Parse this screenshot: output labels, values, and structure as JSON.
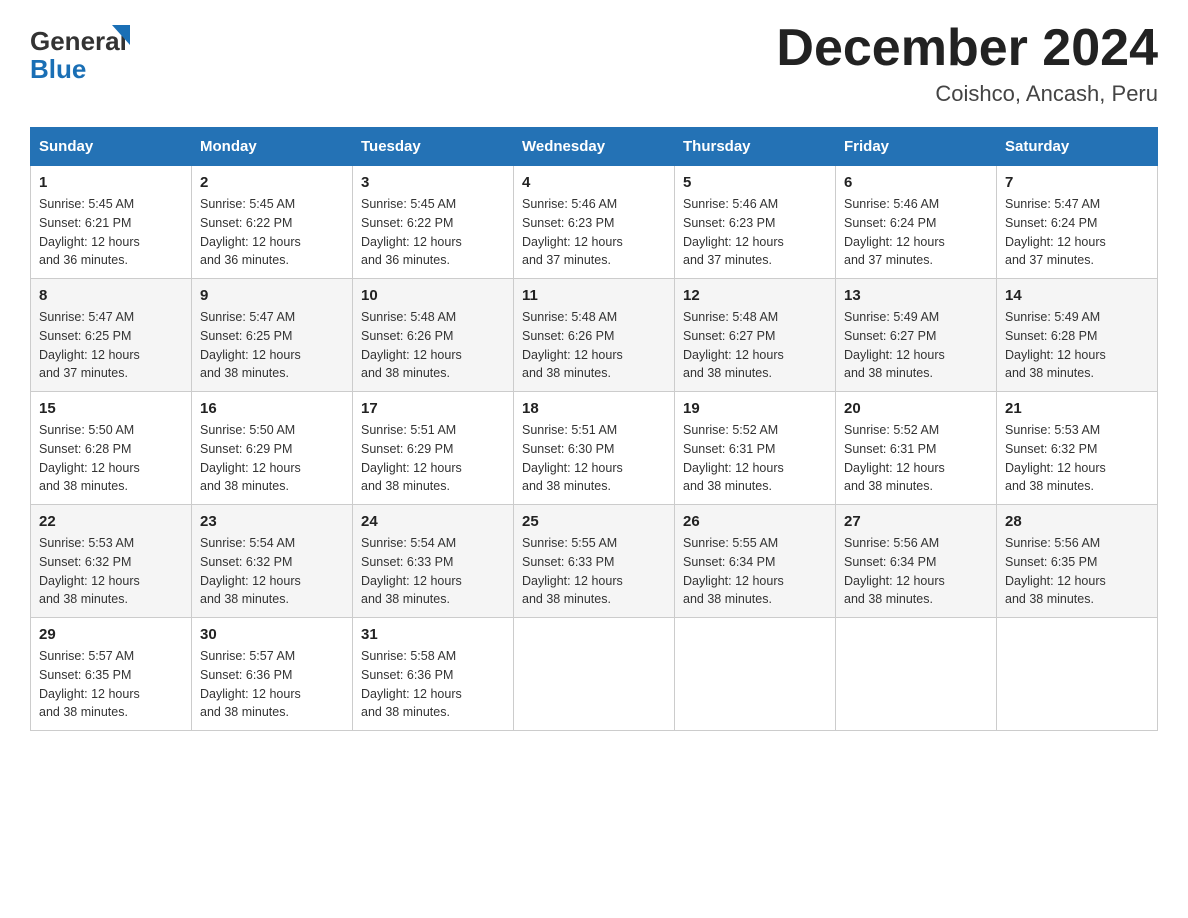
{
  "header": {
    "title": "December 2024",
    "subtitle": "Coishco, Ancash, Peru"
  },
  "days_of_week": [
    "Sunday",
    "Monday",
    "Tuesday",
    "Wednesday",
    "Thursday",
    "Friday",
    "Saturday"
  ],
  "weeks": [
    [
      {
        "day": "1",
        "sunrise": "5:45 AM",
        "sunset": "6:21 PM",
        "daylight": "12 hours and 36 minutes."
      },
      {
        "day": "2",
        "sunrise": "5:45 AM",
        "sunset": "6:22 PM",
        "daylight": "12 hours and 36 minutes."
      },
      {
        "day": "3",
        "sunrise": "5:45 AM",
        "sunset": "6:22 PM",
        "daylight": "12 hours and 36 minutes."
      },
      {
        "day": "4",
        "sunrise": "5:46 AM",
        "sunset": "6:23 PM",
        "daylight": "12 hours and 37 minutes."
      },
      {
        "day": "5",
        "sunrise": "5:46 AM",
        "sunset": "6:23 PM",
        "daylight": "12 hours and 37 minutes."
      },
      {
        "day": "6",
        "sunrise": "5:46 AM",
        "sunset": "6:24 PM",
        "daylight": "12 hours and 37 minutes."
      },
      {
        "day": "7",
        "sunrise": "5:47 AM",
        "sunset": "6:24 PM",
        "daylight": "12 hours and 37 minutes."
      }
    ],
    [
      {
        "day": "8",
        "sunrise": "5:47 AM",
        "sunset": "6:25 PM",
        "daylight": "12 hours and 37 minutes."
      },
      {
        "day": "9",
        "sunrise": "5:47 AM",
        "sunset": "6:25 PM",
        "daylight": "12 hours and 38 minutes."
      },
      {
        "day": "10",
        "sunrise": "5:48 AM",
        "sunset": "6:26 PM",
        "daylight": "12 hours and 38 minutes."
      },
      {
        "day": "11",
        "sunrise": "5:48 AM",
        "sunset": "6:26 PM",
        "daylight": "12 hours and 38 minutes."
      },
      {
        "day": "12",
        "sunrise": "5:48 AM",
        "sunset": "6:27 PM",
        "daylight": "12 hours and 38 minutes."
      },
      {
        "day": "13",
        "sunrise": "5:49 AM",
        "sunset": "6:27 PM",
        "daylight": "12 hours and 38 minutes."
      },
      {
        "day": "14",
        "sunrise": "5:49 AM",
        "sunset": "6:28 PM",
        "daylight": "12 hours and 38 minutes."
      }
    ],
    [
      {
        "day": "15",
        "sunrise": "5:50 AM",
        "sunset": "6:28 PM",
        "daylight": "12 hours and 38 minutes."
      },
      {
        "day": "16",
        "sunrise": "5:50 AM",
        "sunset": "6:29 PM",
        "daylight": "12 hours and 38 minutes."
      },
      {
        "day": "17",
        "sunrise": "5:51 AM",
        "sunset": "6:29 PM",
        "daylight": "12 hours and 38 minutes."
      },
      {
        "day": "18",
        "sunrise": "5:51 AM",
        "sunset": "6:30 PM",
        "daylight": "12 hours and 38 minutes."
      },
      {
        "day": "19",
        "sunrise": "5:52 AM",
        "sunset": "6:31 PM",
        "daylight": "12 hours and 38 minutes."
      },
      {
        "day": "20",
        "sunrise": "5:52 AM",
        "sunset": "6:31 PM",
        "daylight": "12 hours and 38 minutes."
      },
      {
        "day": "21",
        "sunrise": "5:53 AM",
        "sunset": "6:32 PM",
        "daylight": "12 hours and 38 minutes."
      }
    ],
    [
      {
        "day": "22",
        "sunrise": "5:53 AM",
        "sunset": "6:32 PM",
        "daylight": "12 hours and 38 minutes."
      },
      {
        "day": "23",
        "sunrise": "5:54 AM",
        "sunset": "6:32 PM",
        "daylight": "12 hours and 38 minutes."
      },
      {
        "day": "24",
        "sunrise": "5:54 AM",
        "sunset": "6:33 PM",
        "daylight": "12 hours and 38 minutes."
      },
      {
        "day": "25",
        "sunrise": "5:55 AM",
        "sunset": "6:33 PM",
        "daylight": "12 hours and 38 minutes."
      },
      {
        "day": "26",
        "sunrise": "5:55 AM",
        "sunset": "6:34 PM",
        "daylight": "12 hours and 38 minutes."
      },
      {
        "day": "27",
        "sunrise": "5:56 AM",
        "sunset": "6:34 PM",
        "daylight": "12 hours and 38 minutes."
      },
      {
        "day": "28",
        "sunrise": "5:56 AM",
        "sunset": "6:35 PM",
        "daylight": "12 hours and 38 minutes."
      }
    ],
    [
      {
        "day": "29",
        "sunrise": "5:57 AM",
        "sunset": "6:35 PM",
        "daylight": "12 hours and 38 minutes."
      },
      {
        "day": "30",
        "sunrise": "5:57 AM",
        "sunset": "6:36 PM",
        "daylight": "12 hours and 38 minutes."
      },
      {
        "day": "31",
        "sunrise": "5:58 AM",
        "sunset": "6:36 PM",
        "daylight": "12 hours and 38 minutes."
      },
      null,
      null,
      null,
      null
    ]
  ],
  "labels": {
    "sunrise": "Sunrise:",
    "sunset": "Sunset:",
    "daylight": "Daylight:"
  },
  "colors": {
    "header_bg": "#2472b5",
    "header_text": "#ffffff",
    "border": "#cccccc"
  }
}
